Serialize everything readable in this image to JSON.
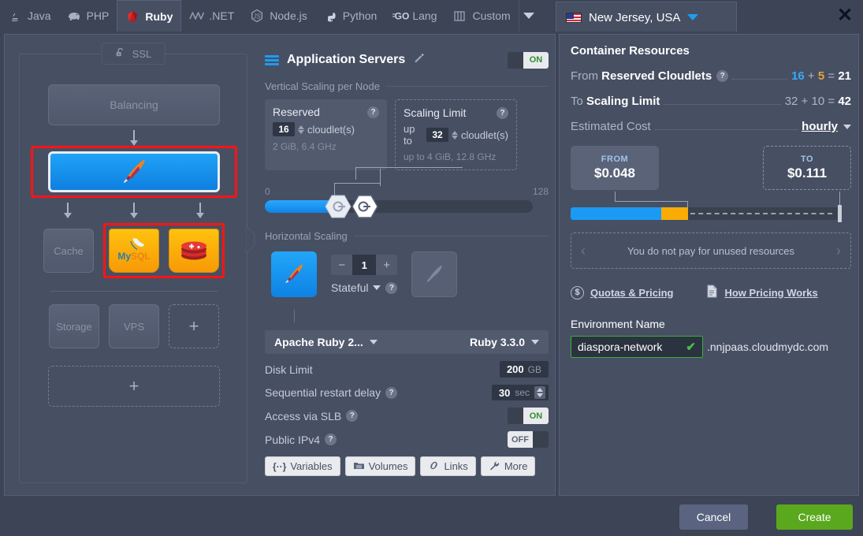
{
  "tabs": [
    {
      "label": "Java",
      "icon": "java-icon",
      "active": false
    },
    {
      "label": "PHP",
      "icon": "php-elephant-icon",
      "active": false
    },
    {
      "label": "Ruby",
      "icon": "ruby-gem-icon",
      "active": true
    },
    {
      "label": ".NET",
      "icon": "dotnet-icon",
      "active": false
    },
    {
      "label": "Node.js",
      "icon": "nodejs-icon",
      "active": false
    },
    {
      "label": "Python",
      "icon": "python-icon",
      "active": false
    },
    {
      "label": "Lang",
      "icon": "go-lang-icon",
      "active": false
    },
    {
      "label": "Custom",
      "icon": "custom-columns-icon",
      "active": false
    }
  ],
  "tab_overflow_icon": "chevron-down-icon",
  "region": {
    "label": "New Jersey, USA",
    "flag": "us-flag-icon",
    "caret": "chevron-down-icon"
  },
  "close_label": "✕",
  "topology": {
    "ssl_label": "SSL",
    "ssl_icon": "padlock-open-icon",
    "balancing_label": "Balancing",
    "app_node_icon": "apache-feather-icon",
    "cache_label": "Cache",
    "db_nodes": [
      {
        "label": "MySQL",
        "icon": "mysql-dolphin-icon"
      },
      {
        "label": "Redis",
        "icon": "redis-stack-icon"
      }
    ],
    "storage_label": "Storage",
    "vps_label": "VPS",
    "add_label": "+",
    "add_wide_label": "+"
  },
  "settings": {
    "section_title": "Application Servers",
    "menu_icon": "hamburger-icon",
    "edit_icon": "pencil-icon",
    "power_toggle": "ON",
    "vertical_scaling_title": "Vertical Scaling per Node",
    "reserved": {
      "title": "Reserved",
      "value": "16",
      "unit": "cloudlet(s)",
      "sub": "2 GiB, 6.4 GHz",
      "help": "?"
    },
    "scaling_limit": {
      "title": "Scaling Limit",
      "prefix": "up to",
      "value": "32",
      "unit": "cloudlet(s)",
      "sub_prefix": "up to",
      "sub": "4 GiB, 12.8 GHz",
      "help": "?"
    },
    "slider": {
      "min": "0",
      "max": "128"
    },
    "horizontal_scaling_title": "Horizontal Scaling",
    "node_count": "1",
    "minus_label": "−",
    "plus_label": "+",
    "stateful_label": "Stateful",
    "stateful_help": "?",
    "stack_name": "Apache Ruby 2...",
    "engine_version": "Ruby 3.3.0",
    "disk_limit_label": "Disk Limit",
    "disk_limit_value": "200",
    "disk_limit_unit": "GB",
    "restart_delay_label": "Sequential restart delay",
    "restart_delay_value": "30",
    "restart_delay_unit": "sec",
    "slb_label": "Access via SLB",
    "slb_toggle": "ON",
    "ipv4_label": "Public IPv4",
    "ipv4_toggle": "OFF",
    "buttons": [
      {
        "label": "Variables",
        "icon": "braces-icon"
      },
      {
        "label": "Volumes",
        "icon": "folder-icon"
      },
      {
        "label": "Links",
        "icon": "link-chain-icon"
      },
      {
        "label": "More",
        "icon": "wrench-icon"
      }
    ]
  },
  "resources": {
    "title": "Container Resources",
    "from_label_prefix": "From",
    "from_label": "Reserved Cloudlets",
    "from_help": "?",
    "from_a": "16",
    "from_plus": "+",
    "from_b": "5",
    "from_eq": "=",
    "from_total": "21",
    "to_label_prefix": "To",
    "to_label": "Scaling Limit",
    "to_a": "32",
    "to_plus": "+",
    "to_b": "10",
    "to_eq": "=",
    "to_total": "42",
    "cost_label": "Estimated Cost",
    "cost_period": "hourly",
    "cost_caret": "chevron-down-icon",
    "price_from_key": "FROM",
    "price_from_value": "$0.048",
    "price_to_key": "TO",
    "price_to_value": "$0.111",
    "note": "You do not pay for unused resources",
    "note_prev": "‹",
    "note_next": "›",
    "links": [
      {
        "label": "Quotas & Pricing",
        "icon": "dollar-circle-icon"
      },
      {
        "label": "How Pricing Works",
        "icon": "document-icon"
      }
    ],
    "env_name_label": "Environment Name",
    "env_name_value": "diaspora-network",
    "env_valid_icon": "green-check-icon",
    "env_domain": ".nnjpaas.cloudmydc.com"
  },
  "footer": {
    "cancel_label": "Cancel",
    "create_label": "Create"
  },
  "colors": {
    "accent_blue": "#1b9af5",
    "amber": "#f9ab06",
    "green": "#5aa81e",
    "selection_red": "#ff1414",
    "panel": "#474f63",
    "background": "#3c4456"
  }
}
